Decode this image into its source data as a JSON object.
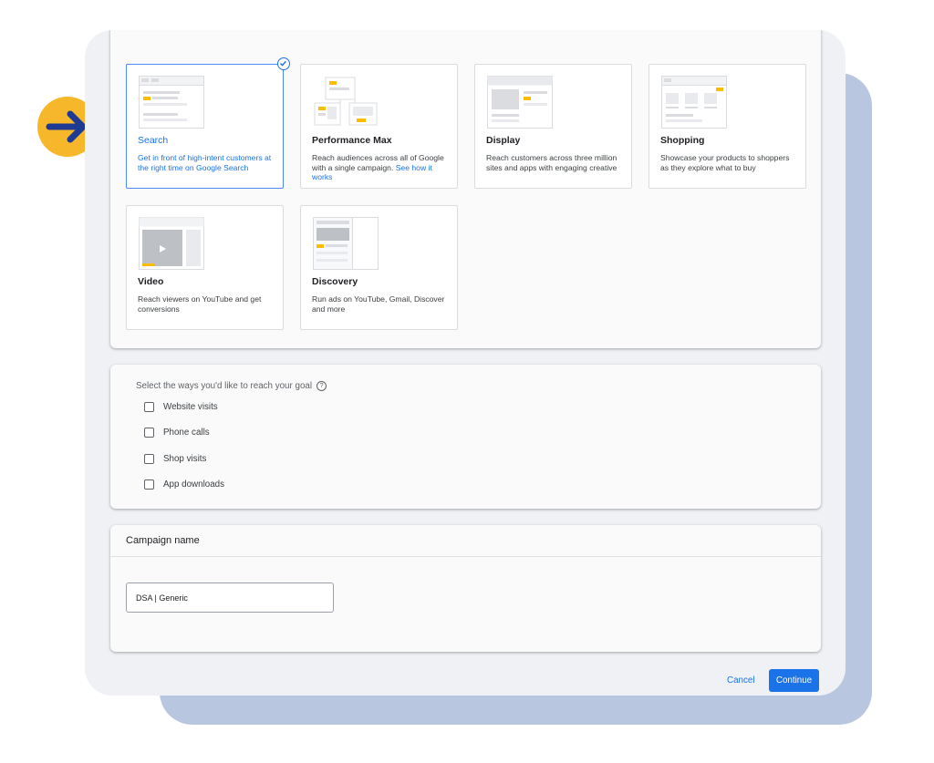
{
  "campaign_types": [
    {
      "title": "Search",
      "description": "Get in front of high-intent customers at the right time on Google Search",
      "selected": true
    },
    {
      "title": "Performance Max",
      "description": "Reach audiences across all of Google with a single campaign.",
      "link": "See how it works",
      "selected": false
    },
    {
      "title": "Display",
      "description": "Reach customers across three million sites and apps with engaging creative",
      "selected": false
    },
    {
      "title": "Shopping",
      "description": "Showcase your products to shoppers as they explore what to buy",
      "selected": false
    },
    {
      "title": "Video",
      "description": "Reach viewers on YouTube and get conversions",
      "selected": false
    },
    {
      "title": "Discovery",
      "description": "Run ads on YouTube, Gmail, Discover and more",
      "selected": false
    }
  ],
  "goal_section": {
    "heading": "Select the ways you'd like to reach your goal",
    "help_glyph": "?",
    "options": [
      {
        "label": "Website visits",
        "checked": false
      },
      {
        "label": "Phone calls",
        "checked": false
      },
      {
        "label": "Shop visits",
        "checked": false
      },
      {
        "label": "App downloads",
        "checked": false
      }
    ]
  },
  "campaign_name": {
    "heading": "Campaign name",
    "value": "DSA | Generic"
  },
  "footer": {
    "cancel_label": "Cancel",
    "continue_label": "Continue"
  },
  "colors": {
    "accent": "#1a73e8",
    "selected_border": "#4c8bf5",
    "arrow_badge": "#f6b82a",
    "arrow": "#1f3a93",
    "backplate": "#b8c6e0",
    "thumb_highlight": "#fbbc04"
  },
  "icons": {
    "pointer": "arrow-right-icon",
    "selected": "check-circle-icon",
    "help": "help-circle-icon"
  }
}
